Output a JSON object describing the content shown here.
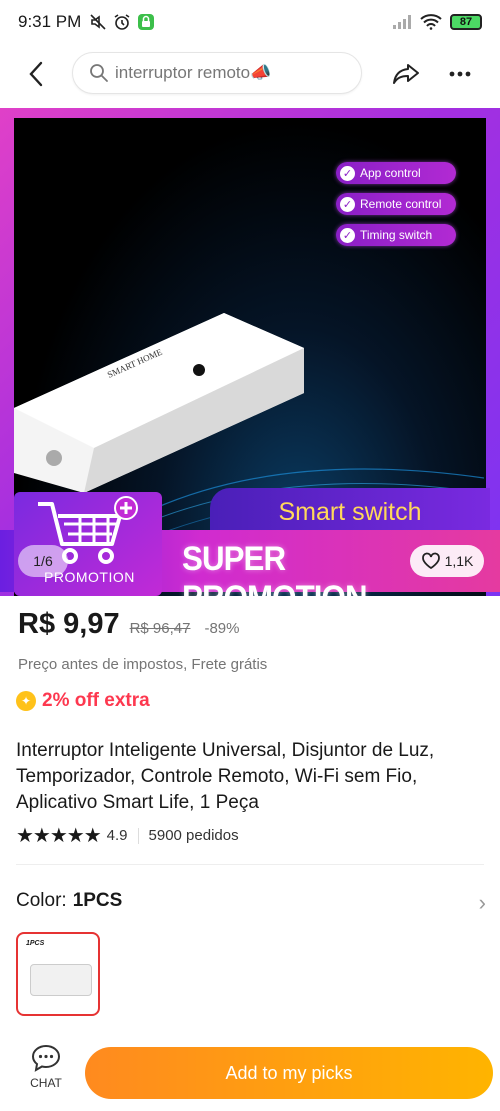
{
  "status_bar": {
    "time": "9:31 PM",
    "battery": "87"
  },
  "search": {
    "query": "interruptor remoto📣"
  },
  "image": {
    "feature_tags": [
      "App control",
      "Remote control",
      "Timing switch"
    ],
    "device_brand": "SMART HOME",
    "banner_text": "Smart switch",
    "promo_text": "SUPER PROMOTION",
    "promotion_label": "PROMOTION",
    "page_counter": "1/6",
    "likes": "1,1K"
  },
  "price": {
    "current": "R$ 9,97",
    "original": "R$ 96,47",
    "discount": "-89%",
    "tax_note": "Preço antes de impostos, Frete grátis",
    "extra_off": "2% off extra"
  },
  "product": {
    "title": "Interruptor Inteligente Universal, Disjuntor de Luz, Temporizador, Controle Remoto, Wi-Fi sem Fio, Aplicativo Smart Life, 1 Peça",
    "rating": "4.9",
    "orders": "5900 pedidos"
  },
  "variant": {
    "label": "Color:",
    "value": "1PCS",
    "thumb_label": "1PCS"
  },
  "bottom": {
    "chat_label": "CHAT",
    "add_label": "Add to my picks"
  },
  "colors": {
    "price_red": "#fd384f",
    "cta_orange": "#ff8a1f",
    "cta_yellow": "#ffb400"
  }
}
